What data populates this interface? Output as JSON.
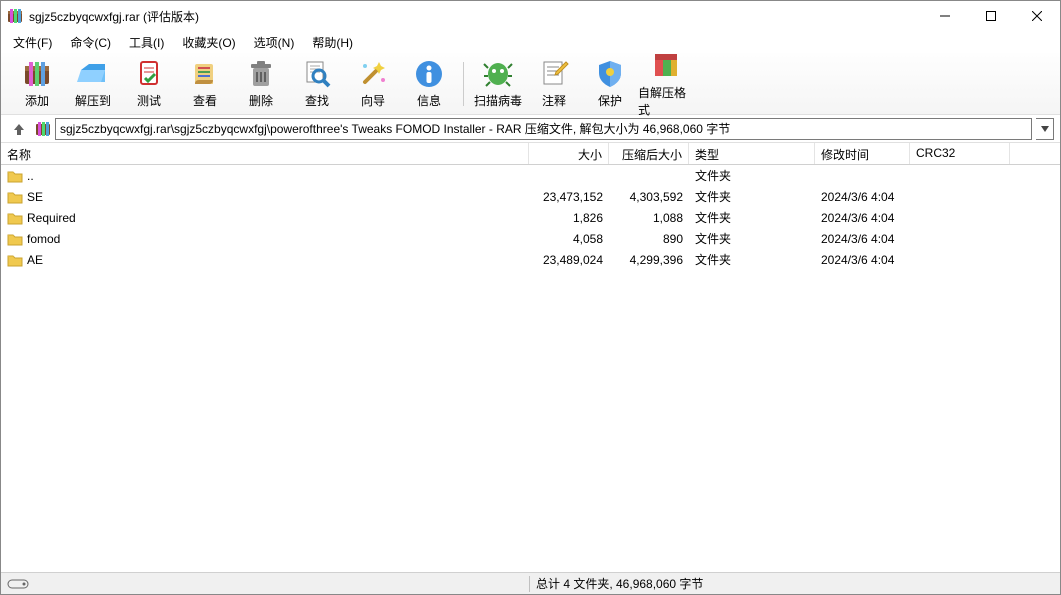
{
  "window": {
    "title": "sgjz5czbyqcwxfgj.rar (评估版本)"
  },
  "menus": {
    "file": "文件(F)",
    "commands": "命令(C)",
    "tools": "工具(I)",
    "favorites": "收藏夹(O)",
    "options": "选项(N)",
    "help": "帮助(H)"
  },
  "toolbar": {
    "add": "添加",
    "extract": "解压到",
    "test": "测试",
    "view": "查看",
    "delete": "删除",
    "find": "查找",
    "wizard": "向导",
    "info": "信息",
    "scan": "扫描病毒",
    "comment": "注释",
    "protect": "保护",
    "sfx": "自解压格式"
  },
  "path": "sgjz5czbyqcwxfgj.rar\\sgjz5czbyqcwxfgj\\powerofthree's Tweaks FOMOD Installer - RAR 压缩文件, 解包大小为 46,968,060 字节",
  "columns": {
    "name": "名称",
    "size": "大小",
    "packed": "压缩后大小",
    "type": "类型",
    "mtime": "修改时间",
    "crc": "CRC32"
  },
  "rows": [
    {
      "name": "..",
      "size": "",
      "packed": "",
      "type": "文件夹",
      "mtime": ""
    },
    {
      "name": "SE",
      "size": "23,473,152",
      "packed": "4,303,592",
      "type": "文件夹",
      "mtime": "2024/3/6 4:04"
    },
    {
      "name": "Required",
      "size": "1,826",
      "packed": "1,088",
      "type": "文件夹",
      "mtime": "2024/3/6 4:04"
    },
    {
      "name": "fomod",
      "size": "4,058",
      "packed": "890",
      "type": "文件夹",
      "mtime": "2024/3/6 4:04"
    },
    {
      "name": "AE",
      "size": "23,489,024",
      "packed": "4,299,396",
      "type": "文件夹",
      "mtime": "2024/3/6 4:04"
    }
  ],
  "status": {
    "summary": "总计 4 文件夹, 46,968,060 字节"
  }
}
